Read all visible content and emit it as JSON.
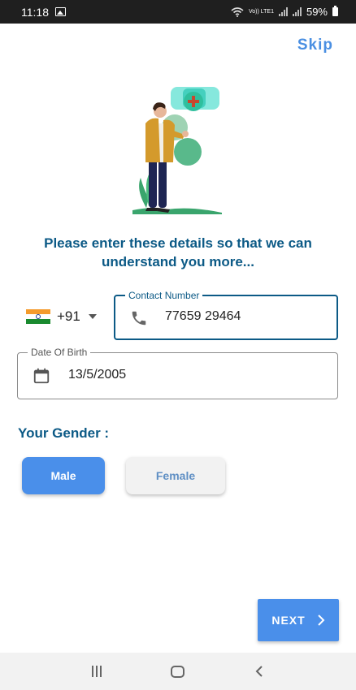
{
  "status_bar": {
    "time": "11:18",
    "network": "Vo)) LTE1",
    "battery": "59%"
  },
  "skip_label": "Skip",
  "headline": "Please enter these details so that we can understand you more...",
  "phone": {
    "dial_code": "+91",
    "label": "Contact Number",
    "value": "77659 29464"
  },
  "dob": {
    "label": "Date Of Birth",
    "value": "13/5/2005"
  },
  "gender": {
    "title": "Your Gender :",
    "options": [
      "Male",
      "Female"
    ],
    "selected": "Male"
  },
  "next_label": "NEXT",
  "colors": {
    "primary": "#4a8fea",
    "heading": "#0c5a86"
  },
  "icons": [
    "image-icon",
    "wifi-icon",
    "signal-icon",
    "battery-icon",
    "india-flag-icon",
    "chevron-down-icon",
    "phone-icon",
    "calendar-icon",
    "chevron-right-icon",
    "recent-apps-icon",
    "home-icon",
    "back-icon"
  ]
}
